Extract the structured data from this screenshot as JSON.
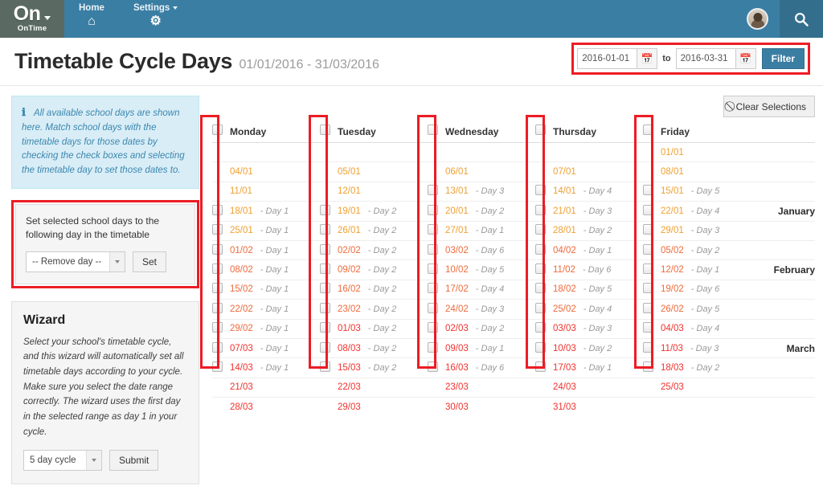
{
  "navbar": {
    "brand": {
      "name": "On",
      "sub": "OnTime",
      "caret_icon": "caret-down-icon"
    },
    "items": [
      {
        "label": "Home",
        "icon": "home-icon",
        "glyph": "⌂",
        "has_caret": false
      },
      {
        "label": "Settings",
        "icon": "gear-icon",
        "glyph": "⚙",
        "has_caret": true
      }
    ],
    "avatar": "user-avatar",
    "search_icon": "search-icon"
  },
  "header": {
    "title": "Timetable Cycle Days",
    "range": "01/01/2016 - 31/03/2016",
    "filter": {
      "from_value": "2016-01-01",
      "to_value": "2016-03-31",
      "from_placeholder": "yyyy-mm-dd",
      "to_placeholder": "yyyy-mm-dd",
      "to_label": "to",
      "calendar_icon": "calendar-icon",
      "button_label": "Filter",
      "accent": "#3b7ea3",
      "highlight": "#ec1c24"
    }
  },
  "sidebar": {
    "info": {
      "icon": "info-icon",
      "text": "All available school days are shown here. Match school days with the timetable days for those dates by checking the check boxes and selecting the timetable day to set those dates to."
    },
    "set_panel": {
      "text": "Set selected school days to the following day in the timetable",
      "select_value": "-- Remove day --",
      "button_label": "Set"
    },
    "wizard": {
      "title": "Wizard",
      "text": "Select your school's timetable cycle, and this wizard will automatically set all timetable days according to your cycle. Make sure you select the date range correctly. The wizard uses the first day in the selected range as day 1 in your cycle.",
      "select_value": "5 day cycle",
      "button_label": "Submit"
    }
  },
  "main": {
    "clear_button": {
      "label": "Clear Selections",
      "icon": "ban-icon"
    },
    "columns": [
      "Monday",
      "Tuesday",
      "Wednesday",
      "Thursday",
      "Friday"
    ],
    "month_col_header": "",
    "rows": [
      {
        "month": "",
        "cells": [
          {
            "date": "",
            "day": "",
            "chk": false,
            "m": ""
          },
          {
            "date": "",
            "day": "",
            "chk": false,
            "m": ""
          },
          {
            "date": "",
            "day": "",
            "chk": false,
            "m": ""
          },
          {
            "date": "",
            "day": "",
            "chk": false,
            "m": ""
          },
          {
            "date": "01/01",
            "day": "",
            "chk": false,
            "m": "jan"
          }
        ]
      },
      {
        "month": "",
        "cells": [
          {
            "date": "04/01",
            "day": "",
            "chk": false,
            "m": "jan"
          },
          {
            "date": "05/01",
            "day": "",
            "chk": false,
            "m": "jan"
          },
          {
            "date": "06/01",
            "day": "",
            "chk": false,
            "m": "jan"
          },
          {
            "date": "07/01",
            "day": "",
            "chk": false,
            "m": "jan"
          },
          {
            "date": "08/01",
            "day": "",
            "chk": false,
            "m": "jan"
          }
        ]
      },
      {
        "month": "",
        "cells": [
          {
            "date": "11/01",
            "day": "",
            "chk": false,
            "m": "jan"
          },
          {
            "date": "12/01",
            "day": "",
            "chk": false,
            "m": "jan"
          },
          {
            "date": "13/01",
            "day": "- Day 3",
            "chk": true,
            "m": "jan"
          },
          {
            "date": "14/01",
            "day": "- Day 4",
            "chk": true,
            "m": "jan"
          },
          {
            "date": "15/01",
            "day": "- Day 5",
            "chk": true,
            "m": "jan"
          }
        ]
      },
      {
        "month": "January",
        "cells": [
          {
            "date": "18/01",
            "day": "- Day 1",
            "chk": true,
            "m": "jan"
          },
          {
            "date": "19/01",
            "day": "- Day 2",
            "chk": true,
            "m": "jan"
          },
          {
            "date": "20/01",
            "day": "- Day 2",
            "chk": true,
            "m": "jan"
          },
          {
            "date": "21/01",
            "day": "- Day 3",
            "chk": true,
            "m": "jan"
          },
          {
            "date": "22/01",
            "day": "- Day 4",
            "chk": true,
            "m": "jan"
          }
        ]
      },
      {
        "month": "",
        "cells": [
          {
            "date": "25/01",
            "day": "- Day 1",
            "chk": true,
            "m": "jan"
          },
          {
            "date": "26/01",
            "day": "- Day 2",
            "chk": true,
            "m": "jan"
          },
          {
            "date": "27/01",
            "day": "- Day 1",
            "chk": true,
            "m": "jan"
          },
          {
            "date": "28/01",
            "day": "- Day 2",
            "chk": true,
            "m": "jan"
          },
          {
            "date": "29/01",
            "day": "- Day 3",
            "chk": true,
            "m": "jan"
          }
        ]
      },
      {
        "month": "",
        "cells": [
          {
            "date": "01/02",
            "day": "- Day 1",
            "chk": true,
            "m": "feb"
          },
          {
            "date": "02/02",
            "day": "- Day 2",
            "chk": true,
            "m": "feb"
          },
          {
            "date": "03/02",
            "day": "- Day 6",
            "chk": true,
            "m": "feb"
          },
          {
            "date": "04/02",
            "day": "- Day 1",
            "chk": true,
            "m": "feb"
          },
          {
            "date": "05/02",
            "day": "- Day 2",
            "chk": true,
            "m": "feb"
          }
        ]
      },
      {
        "month": "February",
        "cells": [
          {
            "date": "08/02",
            "day": "- Day 1",
            "chk": true,
            "m": "feb"
          },
          {
            "date": "09/02",
            "day": "- Day 2",
            "chk": true,
            "m": "feb"
          },
          {
            "date": "10/02",
            "day": "- Day 5",
            "chk": true,
            "m": "feb"
          },
          {
            "date": "11/02",
            "day": "- Day 6",
            "chk": true,
            "m": "feb"
          },
          {
            "date": "12/02",
            "day": "- Day 1",
            "chk": true,
            "m": "feb"
          }
        ]
      },
      {
        "month": "",
        "cells": [
          {
            "date": "15/02",
            "day": "- Day 1",
            "chk": true,
            "m": "feb"
          },
          {
            "date": "16/02",
            "day": "- Day 2",
            "chk": true,
            "m": "feb"
          },
          {
            "date": "17/02",
            "day": "- Day 4",
            "chk": true,
            "m": "feb"
          },
          {
            "date": "18/02",
            "day": "- Day 5",
            "chk": true,
            "m": "feb"
          },
          {
            "date": "19/02",
            "day": "- Day 6",
            "chk": true,
            "m": "feb"
          }
        ]
      },
      {
        "month": "",
        "cells": [
          {
            "date": "22/02",
            "day": "- Day 1",
            "chk": true,
            "m": "feb"
          },
          {
            "date": "23/02",
            "day": "- Day 2",
            "chk": true,
            "m": "feb"
          },
          {
            "date": "24/02",
            "day": "- Day 3",
            "chk": true,
            "m": "feb"
          },
          {
            "date": "25/02",
            "day": "- Day 4",
            "chk": true,
            "m": "feb"
          },
          {
            "date": "26/02",
            "day": "- Day 5",
            "chk": true,
            "m": "feb"
          }
        ]
      },
      {
        "month": "",
        "cells": [
          {
            "date": "29/02",
            "day": "- Day 1",
            "chk": true,
            "m": "feb"
          },
          {
            "date": "01/03",
            "day": "- Day 2",
            "chk": true,
            "m": "mar"
          },
          {
            "date": "02/03",
            "day": "- Day 2",
            "chk": true,
            "m": "mar"
          },
          {
            "date": "03/03",
            "day": "- Day 3",
            "chk": true,
            "m": "mar"
          },
          {
            "date": "04/03",
            "day": "- Day 4",
            "chk": true,
            "m": "mar"
          }
        ]
      },
      {
        "month": "March",
        "cells": [
          {
            "date": "07/03",
            "day": "- Day 1",
            "chk": true,
            "m": "mar"
          },
          {
            "date": "08/03",
            "day": "- Day 2",
            "chk": true,
            "m": "mar"
          },
          {
            "date": "09/03",
            "day": "- Day 1",
            "chk": true,
            "m": "mar"
          },
          {
            "date": "10/03",
            "day": "- Day 2",
            "chk": true,
            "m": "mar"
          },
          {
            "date": "11/03",
            "day": "- Day 3",
            "chk": true,
            "m": "mar"
          }
        ]
      },
      {
        "month": "",
        "cells": [
          {
            "date": "14/03",
            "day": "- Day 1",
            "chk": true,
            "m": "mar"
          },
          {
            "date": "15/03",
            "day": "- Day 2",
            "chk": true,
            "m": "mar"
          },
          {
            "date": "16/03",
            "day": "- Day 6",
            "chk": true,
            "m": "mar"
          },
          {
            "date": "17/03",
            "day": "- Day 1",
            "chk": true,
            "m": "mar"
          },
          {
            "date": "18/03",
            "day": "- Day 2",
            "chk": true,
            "m": "mar"
          }
        ]
      },
      {
        "month": "",
        "cells": [
          {
            "date": "21/03",
            "day": "",
            "chk": false,
            "m": "mar"
          },
          {
            "date": "22/03",
            "day": "",
            "chk": false,
            "m": "mar"
          },
          {
            "date": "23/03",
            "day": "",
            "chk": false,
            "m": "mar"
          },
          {
            "date": "24/03",
            "day": "",
            "chk": false,
            "m": "mar"
          },
          {
            "date": "25/03",
            "day": "",
            "chk": false,
            "m": "mar"
          }
        ]
      },
      {
        "month": "",
        "cells": [
          {
            "date": "28/03",
            "day": "",
            "chk": false,
            "m": "mar"
          },
          {
            "date": "29/03",
            "day": "",
            "chk": false,
            "m": "mar"
          },
          {
            "date": "30/03",
            "day": "",
            "chk": false,
            "m": "mar"
          },
          {
            "date": "31/03",
            "day": "",
            "chk": false,
            "m": "mar"
          },
          {
            "date": "",
            "day": "",
            "chk": false,
            "m": "mar"
          }
        ]
      }
    ]
  }
}
